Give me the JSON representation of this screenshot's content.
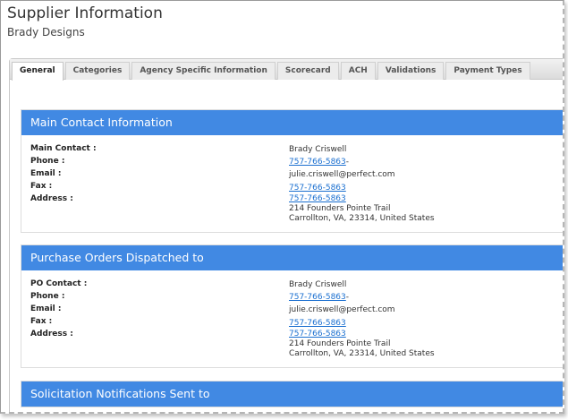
{
  "header": {
    "title": "Supplier Information",
    "subtitle": "Brady Designs"
  },
  "tabs": [
    {
      "label": "General",
      "active": true
    },
    {
      "label": "Categories"
    },
    {
      "label": "Agency Specific Information"
    },
    {
      "label": "Scorecard"
    },
    {
      "label": "ACH"
    },
    {
      "label": "Validations"
    },
    {
      "label": "Payment Types"
    }
  ],
  "sections": [
    {
      "title": "Main Contact Information",
      "labels": {
        "contact": "Main Contact :",
        "phone": "Phone :",
        "email": "Email :",
        "fax": "Fax :",
        "address": "Address :"
      },
      "contact": "Brady Criswell",
      "phone": "757-766-5863",
      "phone_suffix": "-",
      "email": "julie.criswell@perfect.com",
      "fax": "757-766-5863",
      "address_phone": "757-766-5863",
      "address_line1": "214 Founders Pointe Trail",
      "address_line2": "Carrollton, VA, 23314, United States"
    },
    {
      "title": "Purchase Orders Dispatched to",
      "labels": {
        "contact": "PO Contact :",
        "phone": "Phone :",
        "email": "Email :",
        "fax": "Fax :",
        "address": "Address :"
      },
      "contact": "Brady Criswell",
      "phone": "757-766-5863",
      "phone_suffix": "-",
      "email": "julie.criswell@perfect.com",
      "fax": "757-766-5863",
      "address_phone": "757-766-5863",
      "address_line1": "214 Founders Pointe Trail",
      "address_line2": "Carrollton, VA, 23314, United States"
    },
    {
      "title": "Solicitation Notifications Sent to"
    }
  ],
  "colors": {
    "section_header": "#4189e3",
    "link": "#1a6fd0"
  }
}
